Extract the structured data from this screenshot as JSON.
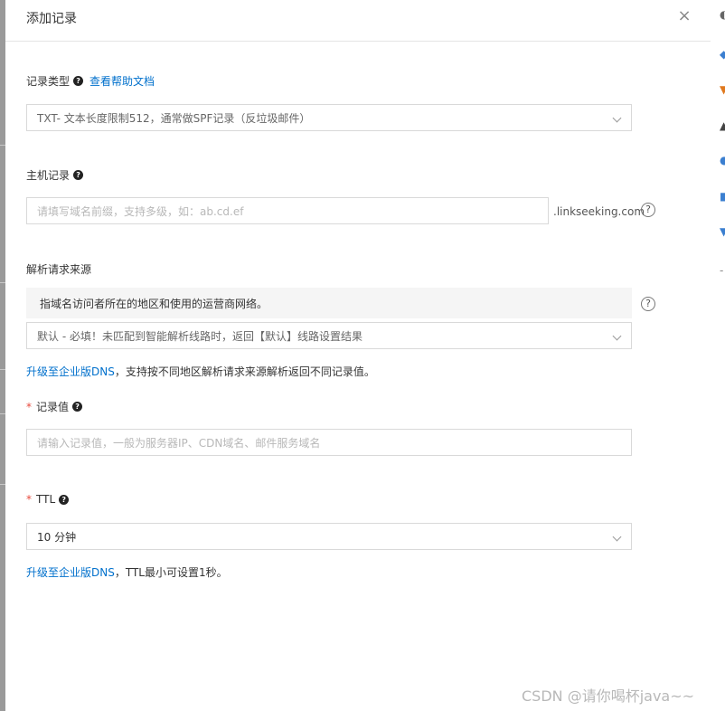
{
  "dialog": {
    "title": "添加记录",
    "close_icon": "close-icon"
  },
  "record_type": {
    "label": "记录类型",
    "help_link": "查看帮助文档",
    "value": "TXT- 文本长度限制512，通常做SPF记录（反垃圾邮件）"
  },
  "host_record": {
    "label": "主机记录",
    "placeholder": "请填写域名前缀，支持多级，如：ab.cd.ef",
    "suffix": ".linkseeking.com"
  },
  "resolve_source": {
    "label": "解析请求来源",
    "info": "指域名访问者所在的地区和使用的运营商网络。",
    "value": "默认 - 必填！未匹配到智能解析线路时，返回【默认】线路设置结果",
    "note_link": "升级至企业版DNS",
    "note_text": "，支持按不同地区解析请求来源解析返回不同记录值。"
  },
  "record_value": {
    "required": "*",
    "label": "记录值",
    "placeholder": "请输入记录值，一般为服务器IP、CDN域名、邮件服务域名"
  },
  "ttl": {
    "required": "*",
    "label": "TTL",
    "value": "10 分钟",
    "note_link": "升级至企业版DNS",
    "note_text": "，TTL最小可设置1秒。"
  },
  "help_glyph": "?",
  "close_glyph": "×",
  "watermark": "CSDN @请你喝杯java~~",
  "colors": {
    "link": "#0070cc",
    "required": "#e84a3e",
    "border": "#d9d9d9",
    "info_bg": "#f5f5f5"
  }
}
